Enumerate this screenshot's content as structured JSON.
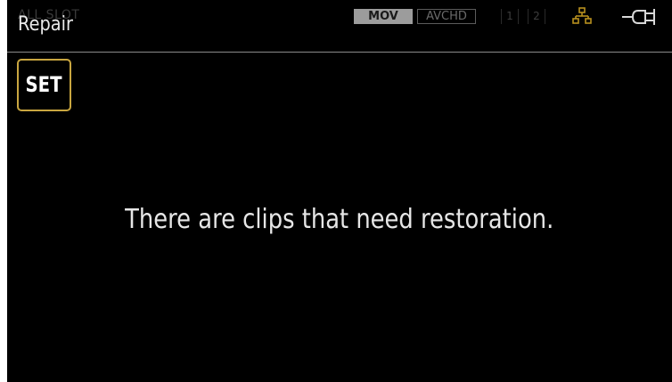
{
  "header": {
    "background_slot_label": "ALL SLOT",
    "title": "Repair",
    "format_badges": {
      "mov": "MOV",
      "avchd": "AVCHD"
    },
    "slots": [
      "1",
      "2"
    ],
    "icons": [
      "network-icon",
      "power-plug-icon"
    ]
  },
  "set_button": {
    "label": "SET",
    "border_color": "#c9a640"
  },
  "main": {
    "message": "There are clips that need restoration."
  },
  "colors": {
    "background": "#000000",
    "text": "#e6e6e6",
    "accent": "#c9a640",
    "network_icon": "#b8901e"
  }
}
